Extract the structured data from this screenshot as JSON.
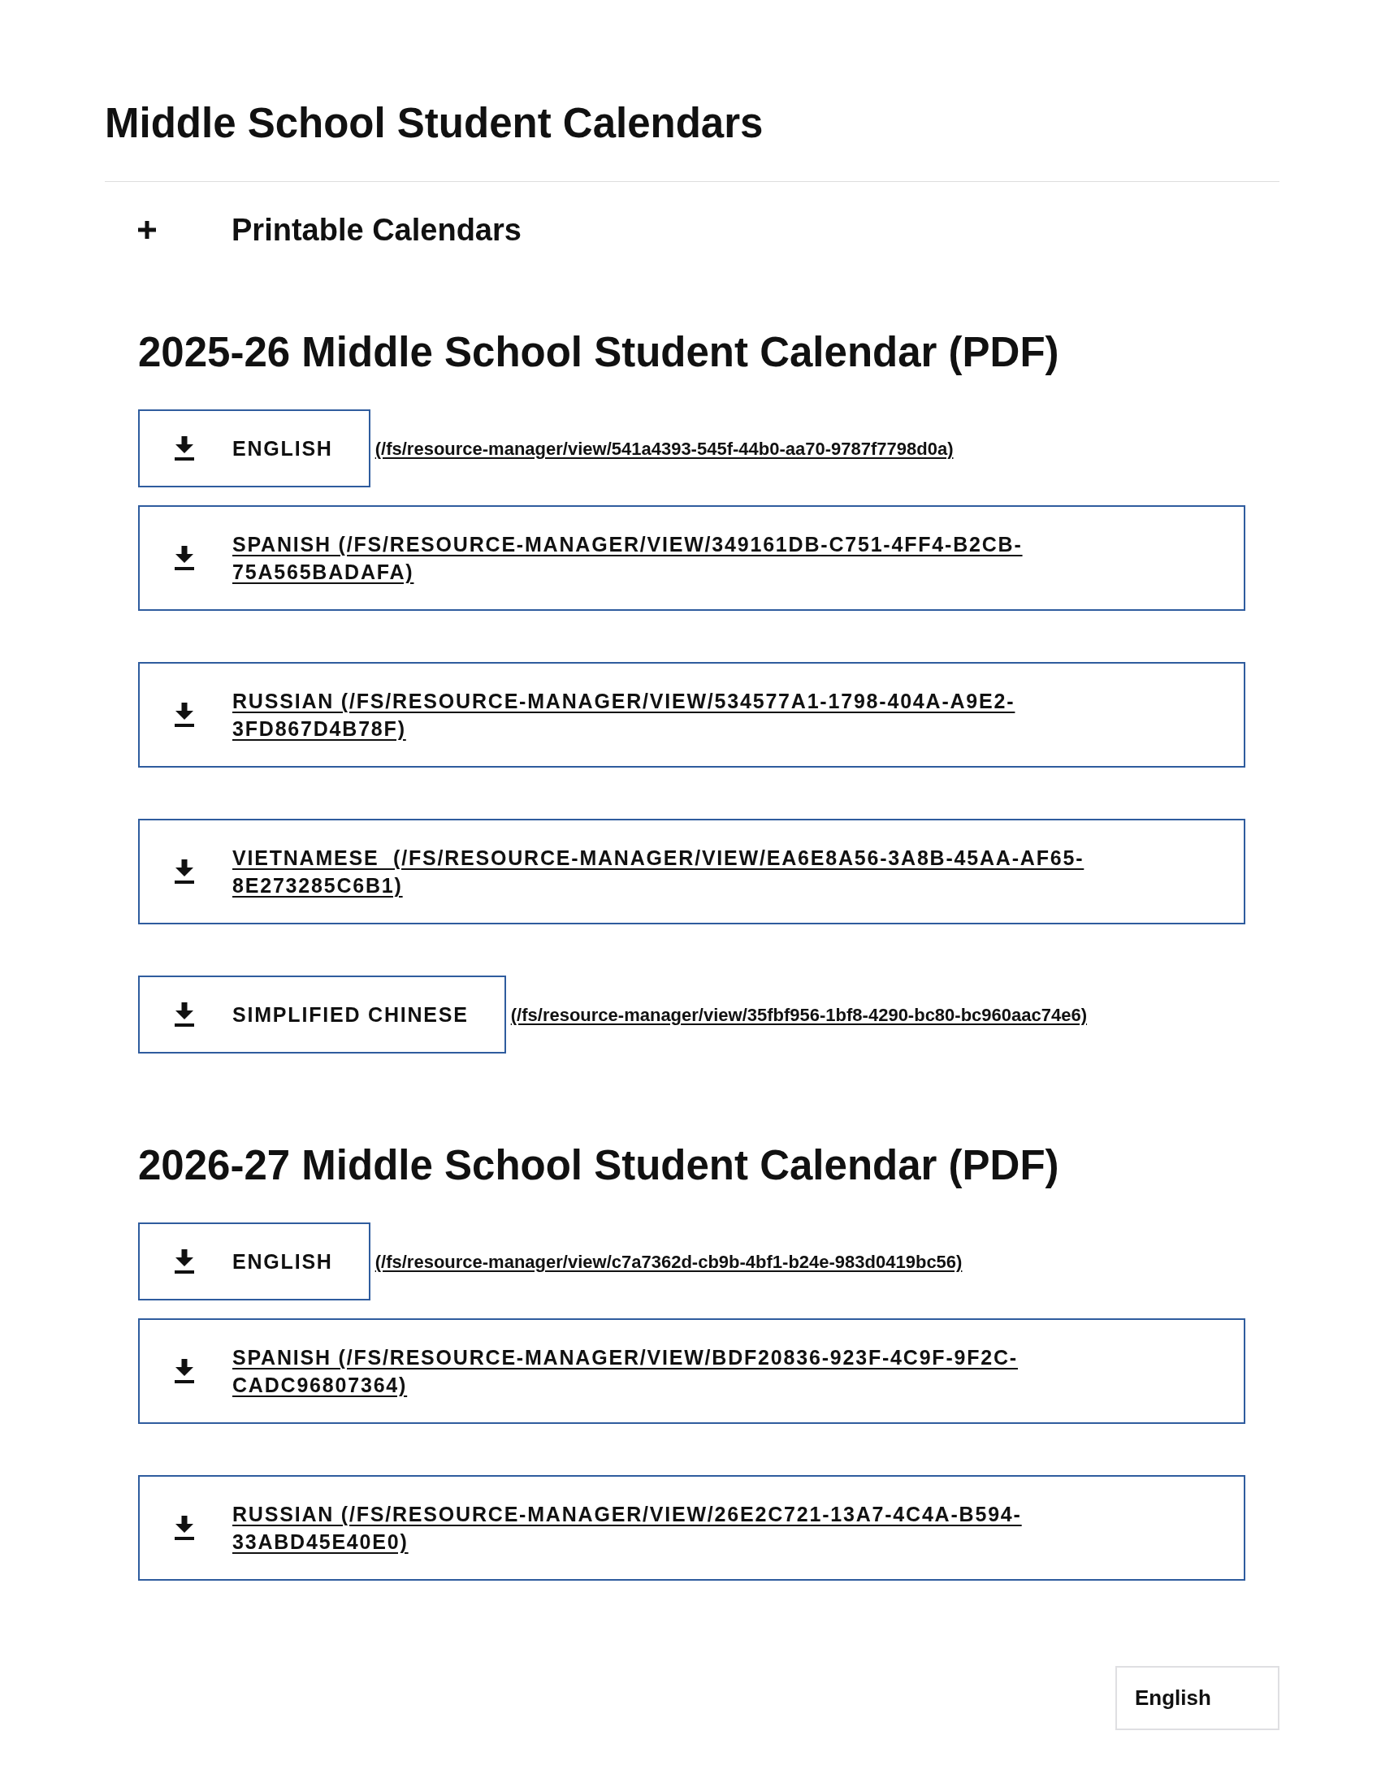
{
  "page_title": "Middle School Student Calendars",
  "accordion": {
    "label": "Printable Calendars",
    "expanded": false
  },
  "sections": [
    {
      "heading": "2025-26 Middle School Student Calendar (PDF)",
      "items": [
        {
          "kind": "button_with_link",
          "label": "ENGLISH",
          "link": "(/fs/resource-manager/view/541a4393-545f-44b0-aa70-9787f7798d0a)"
        },
        {
          "kind": "block_link",
          "label": "SPANISH (/FS/RESOURCE-MANAGER/VIEW/349161DB-C751-4FF4-B2CB-75A565BADAFA)"
        },
        {
          "kind": "block_link",
          "label": "RUSSIAN (/FS/RESOURCE-MANAGER/VIEW/534577A1-1798-404A-A9E2-3FD867D4B78F)"
        },
        {
          "kind": "block_link",
          "label": "VIETNAMESE  (/FS/RESOURCE-MANAGER/VIEW/EA6E8A56-3A8B-45AA-AF65-8E273285C6B1)"
        },
        {
          "kind": "button_with_link",
          "label": "SIMPLIFIED CHINESE",
          "link": "(/fs/resource-manager/view/35fbf956-1bf8-4290-bc80-bc960aac74e6)"
        }
      ]
    },
    {
      "heading": "2026-27 Middle School Student Calendar (PDF)",
      "items": [
        {
          "kind": "button_with_link",
          "label": "ENGLISH",
          "link": "(/fs/resource-manager/view/c7a7362d-cb9b-4bf1-b24e-983d0419bc56)"
        },
        {
          "kind": "block_link",
          "label": "SPANISH (/FS/RESOURCE-MANAGER/VIEW/BDF20836-923F-4C9F-9F2C-CADC96807364)"
        },
        {
          "kind": "block_link",
          "label": "RUSSIAN (/FS/RESOURCE-MANAGER/VIEW/26E2C721-13A7-4C4A-B594-33ABD45E40E0)"
        }
      ]
    }
  ],
  "language_selector": {
    "value": "English"
  }
}
